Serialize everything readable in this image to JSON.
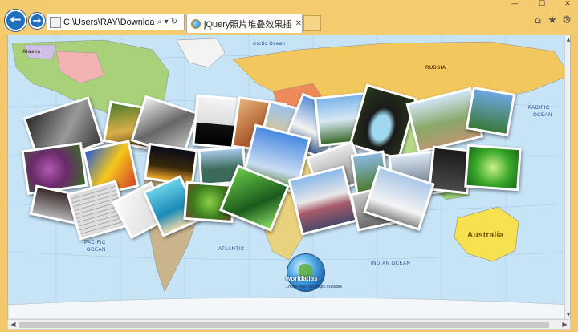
{
  "window": {
    "minimize_glyph": "—",
    "maximize_glyph": "☐",
    "close_glyph": "✕"
  },
  "nav": {
    "back_glyph": "←",
    "forward_glyph": "→"
  },
  "address_bar": {
    "url": "C:\\Users\\RAY\\Downloads\\xxxx",
    "search_glyph": "⌕",
    "dropdown_glyph": "▾",
    "refresh_glyph": "↻"
  },
  "tab": {
    "title": "jQuery照片堆叠效果插件P...",
    "close_glyph": "✕"
  },
  "toolbar": {
    "home_glyph": "⌂",
    "favorites_glyph": "★",
    "settings_glyph": "⚙"
  },
  "map_labels": {
    "arctic_ocean": "Arctic Ocean",
    "pacific_ocean_right": "PACIFIC",
    "ocean_right": "OCEAN",
    "pacific_ocean_left": "PACIFIC",
    "ocean_left": "OCEAN",
    "atlantic": "ATLANTIC",
    "indian_ocean": "INDIAN OCEAN",
    "australia": "Australia",
    "alaska": "Alaska",
    "russia": "RUSSIA"
  },
  "logo": {
    "brand": "worldatlas",
    "tagline": "...more than 700 maps available"
  },
  "scrollbar": {
    "left_glyph": "◀",
    "right_glyph": "▶",
    "up_glyph": "▲",
    "down_glyph": "▼"
  },
  "colors": {
    "chrome": "#f4cb6e",
    "ocean": "#c7e4f7",
    "accent_blue": "#1f6fbd"
  }
}
